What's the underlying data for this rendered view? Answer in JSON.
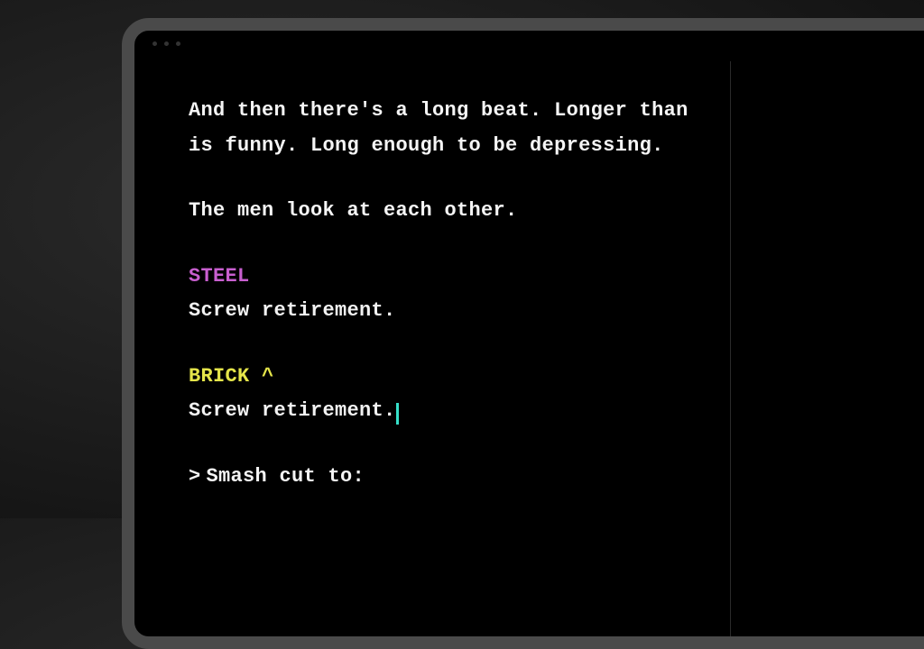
{
  "screenplay": {
    "action1_line1": "And then there's a long beat. Longer than",
    "action1_line2": "is funny. Long enough to be depressing.",
    "action2": "The men look at each other.",
    "cue1": {
      "character": "STEEL",
      "dialogue": "Screw retirement."
    },
    "cue2": {
      "character": "BRICK",
      "caret": "^",
      "dialogue": "Screw retirement."
    },
    "transition_prompt": ">",
    "transition_text": "Smash cut to:"
  },
  "colors": {
    "steel": "#c85fcf",
    "brick": "#e5e54a",
    "cursor": "#36e0c9"
  }
}
